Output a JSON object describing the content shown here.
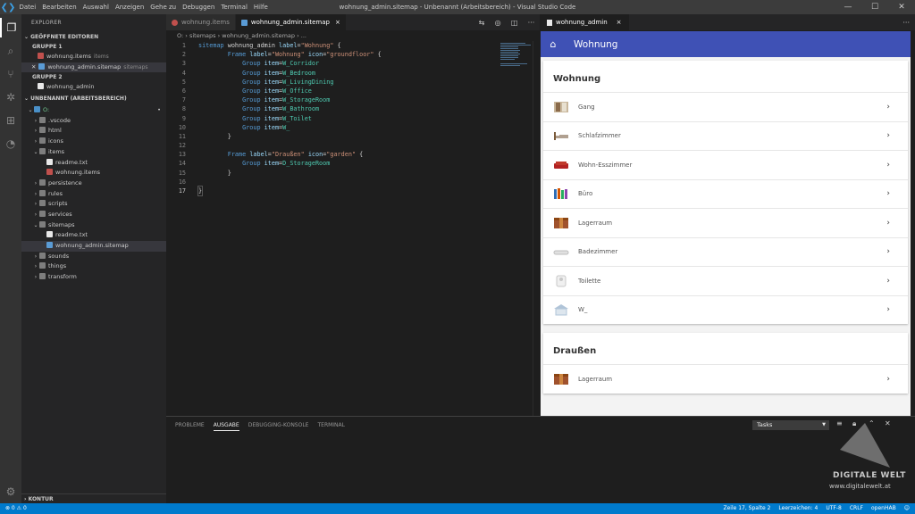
{
  "window": {
    "title": "wohnung_admin.sitemap - Unbenannt (Arbeitsbereich) - Visual Studio Code",
    "menu": [
      "Datei",
      "Bearbeiten",
      "Auswahl",
      "Anzeigen",
      "Gehe zu",
      "Debuggen",
      "Terminal",
      "Hilfe"
    ]
  },
  "sidebar": {
    "header": "EXPLORER",
    "open_editors": {
      "title": "GEÖFFNETE EDITOREN",
      "group1": "GRUPPE 1",
      "group1_items": [
        {
          "name": "wohnung.items",
          "desc": "items"
        },
        {
          "name": "wohnung_admin.sitemap",
          "desc": "sitemaps"
        }
      ],
      "group2": "GRUPPE 2",
      "group2_items": [
        {
          "name": "wohnung_admin"
        }
      ]
    },
    "workspace": {
      "title": "UNBENANNT (ARBEITSBEREICH)",
      "root": "O:",
      "tree": [
        {
          "name": ".vscode"
        },
        {
          "name": "html"
        },
        {
          "name": "icons"
        },
        {
          "name": "items"
        },
        {
          "name": "readme.txt"
        },
        {
          "name": "wohnung.items"
        },
        {
          "name": "persistence"
        },
        {
          "name": "rules"
        },
        {
          "name": "scripts"
        },
        {
          "name": "services"
        },
        {
          "name": "sitemaps"
        },
        {
          "name": "readme.txt"
        },
        {
          "name": "wohnung_admin.sitemap"
        },
        {
          "name": "sounds"
        },
        {
          "name": "things"
        },
        {
          "name": "transform"
        }
      ]
    },
    "outline": "KONTUR"
  },
  "editor": {
    "tabs": [
      {
        "label": "wohnung.items"
      },
      {
        "label": "wohnung_admin.sitemap"
      }
    ],
    "breadcrumb": [
      "O:",
      "sitemaps",
      "wohnung_admin.sitemap",
      "..."
    ],
    "close_glyph": "×",
    "line_numbers": [
      "1",
      "2",
      "3",
      "4",
      "5",
      "6",
      "7",
      "8",
      "9",
      "10",
      "11",
      "12",
      "13",
      "14",
      "15",
      "16",
      "17"
    ],
    "code": {
      "l1_kw": "sitemap",
      "l1_name": " wohnung_admin ",
      "l1_attr": "label",
      "l1_eq": "=",
      "l1_val": "\"Wohnung\"",
      "l1_brace": " {",
      "frame_kw": "Frame",
      "label_attr": "label",
      "icon_attr": "icon",
      "eq": "=",
      "l2_label": "\"Wohnung\"",
      "l2_icon": "\"groundfloor\"",
      "open_brace": " {",
      "group_kw": "Group",
      "item_attr": "item",
      "groups1": [
        "W_Corridor",
        "W_Bedroom",
        "W_LivingDining",
        "W_Office",
        "W_StorageRoom",
        "W_Bathroom",
        "W_Toilet",
        "W_"
      ],
      "close_brace": "}",
      "l13_label": "\"Draußen\"",
      "l13_icon": "\"garden\"",
      "groups2": [
        "D_StorageRoom"
      ]
    }
  },
  "preview": {
    "tab_label": "wohnung_admin",
    "appbar_title": "Wohnung",
    "frames": [
      {
        "title": "Wohnung",
        "items": [
          {
            "label": "Gang"
          },
          {
            "label": "Schlafzimmer"
          },
          {
            "label": "Wohn-Esszimmer"
          },
          {
            "label": "Büro"
          },
          {
            "label": "Lagerraum"
          },
          {
            "label": "Badezimmer"
          },
          {
            "label": "Toilette"
          },
          {
            "label": "W_"
          }
        ]
      },
      {
        "title": "Draußen",
        "items": [
          {
            "label": "Lagerraum"
          }
        ]
      }
    ],
    "accent_color": "#3f51b5"
  },
  "panel": {
    "tabs": [
      "PROBLEME",
      "AUSGABE",
      "DEBUGGING-KONSOLE",
      "TERMINAL"
    ],
    "active_tab": "AUSGABE",
    "tasks_select": "Tasks"
  },
  "watermark": {
    "line1": "DIGITALE WELT",
    "line2": "www.digitalewelt.at"
  },
  "status": {
    "problems": "⊗ 0 ⚠ 0",
    "position": "Zeile 17, Spalte 2",
    "spaces": "Leerzeichen: 4",
    "encoding": "UTF-8",
    "eol": "CRLF",
    "language": "openHAB"
  },
  "colors": {
    "statusbar": "#007acc",
    "sidebar": "#252526",
    "editor": "#1e1e1e"
  }
}
